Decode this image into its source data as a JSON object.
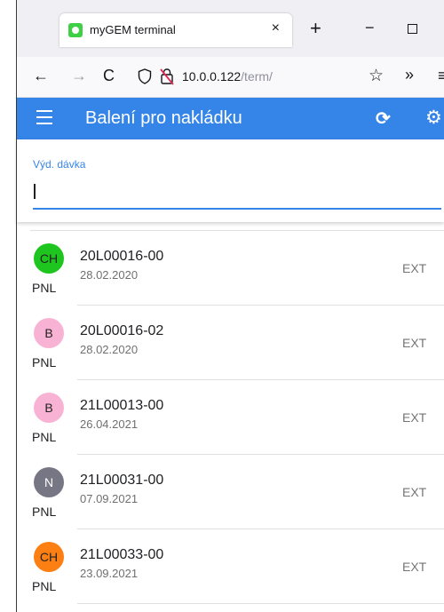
{
  "browser": {
    "tab_title": "myGEM terminal",
    "tab_close": "×",
    "new_tab": "+",
    "win_min": "−",
    "win_close": "×",
    "url_host": "10.0.0.122",
    "url_path": "/term/",
    "back": "←",
    "forward": "→",
    "reload": "C",
    "star": "☆",
    "overflow": "»",
    "menu": "≡"
  },
  "appbar": {
    "title": "Balení pro nakládku",
    "refresh_glyph": "⟳",
    "settings_glyph": "⚙",
    "color": "#3584e8"
  },
  "input": {
    "label": "Výd. dávka",
    "value": ""
  },
  "list": {
    "items": [
      {
        "badge": "CH",
        "badge_color": "#1ec51e",
        "type": "PNL",
        "code": "20L00016-00",
        "date": "28.02.2020",
        "tag": "EXT"
      },
      {
        "badge": "B",
        "badge_color": "#f8b3d4",
        "type": "PNL",
        "code": "20L00016-02",
        "date": "28.02.2020",
        "tag": "EXT"
      },
      {
        "badge": "B",
        "badge_color": "#f8b3d4",
        "type": "PNL",
        "code": "21L00013-00",
        "date": "26.04.2021",
        "tag": "EXT"
      },
      {
        "badge": "N",
        "badge_color": "#767684",
        "type": "PNL",
        "code": "21L00031-00",
        "date": "07.09.2021",
        "tag": "EXT"
      },
      {
        "badge": "CH",
        "badge_color": "#fb7f12",
        "type": "PNL",
        "code": "21L00033-00",
        "date": "23.09.2021",
        "tag": "EXT"
      }
    ]
  }
}
